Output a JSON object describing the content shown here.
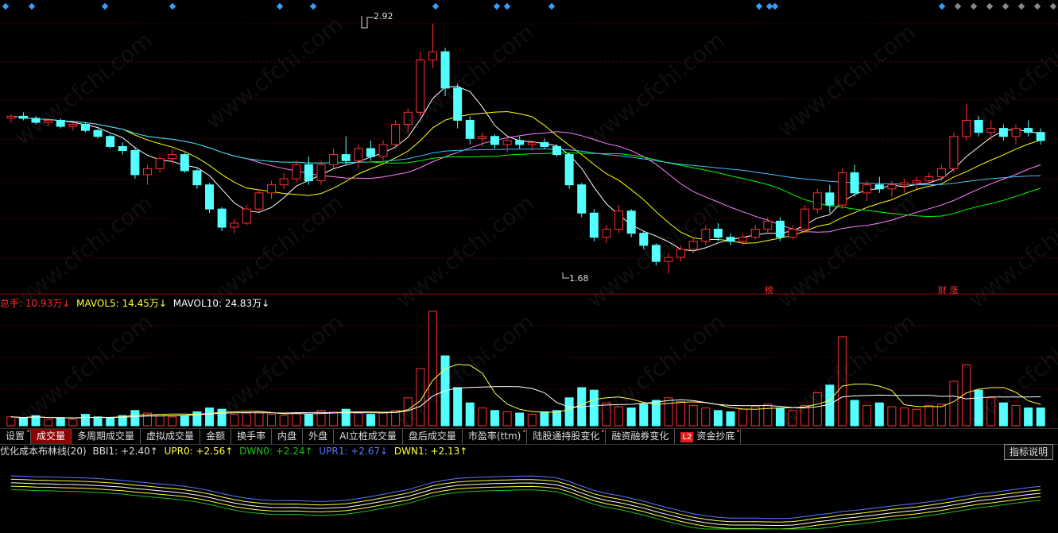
{
  "price_labels": {
    "high": "2.92",
    "low": "1.68"
  },
  "event_labels": [
    "榜",
    "财 涨"
  ],
  "volume_legend": {
    "total": "总手: 10.93万↓",
    "mavol5": "MAVOL5: 14.45万↓",
    "mavol10": "MAVOL10: 24.83万↓"
  },
  "indicator_legend": {
    "name": "优化成本布林线(20)",
    "bbi1": "BBI1: +2.40↑",
    "upr0": "UPR0: +2.56↑",
    "dwn0": "DWN0: +2.24↑",
    "upr1": "UPR1: +2.67↓",
    "dwn1": "DWN1: +2.13↑"
  },
  "tabs": [
    {
      "label": "设置",
      "dot": true
    },
    {
      "label": "成交量",
      "active": true
    },
    {
      "label": "多周期成交量"
    },
    {
      "label": "虚拟成交量"
    },
    {
      "label": "金额"
    },
    {
      "label": "换手率"
    },
    {
      "label": "内盘"
    },
    {
      "label": "外盘"
    },
    {
      "label": "AI立桩成交量"
    },
    {
      "label": "盘后成交量"
    },
    {
      "label": "市盈率(ttm)",
      "dot": true
    },
    {
      "label": "陆股通持股变化",
      "dot": true
    },
    {
      "label": "融资融券变化"
    },
    {
      "label": "资金抄底",
      "badge": "L2",
      "dot": true
    }
  ],
  "help_button": "指标说明",
  "watermark": "www.cfchi.com",
  "colors": {
    "up": "#ff3030",
    "down": "#54ffff",
    "ma5": "#ffffff",
    "ma10": "#ffff00",
    "ma20": "#ff80ff",
    "ma30": "#00ff00",
    "ma60": "#40c0ff",
    "grid": "#5a0000",
    "diamond": "#2fa0ff"
  },
  "chart_data": {
    "type": "candlestick",
    "price_high": 2.92,
    "price_low": 1.68,
    "candles": [
      [
        2.45,
        2.47,
        2.43,
        2.46
      ],
      [
        2.46,
        2.48,
        2.44,
        2.45
      ],
      [
        2.45,
        2.46,
        2.42,
        2.43
      ],
      [
        2.43,
        2.45,
        2.41,
        2.44
      ],
      [
        2.44,
        2.45,
        2.4,
        2.41
      ],
      [
        2.41,
        2.43,
        2.39,
        2.42
      ],
      [
        2.42,
        2.43,
        2.38,
        2.39
      ],
      [
        2.39,
        2.4,
        2.35,
        2.36
      ],
      [
        2.36,
        2.37,
        2.3,
        2.31
      ],
      [
        2.31,
        2.33,
        2.27,
        2.29
      ],
      [
        2.29,
        2.31,
        2.15,
        2.17
      ],
      [
        2.17,
        2.22,
        2.12,
        2.2
      ],
      [
        2.2,
        2.26,
        2.18,
        2.25
      ],
      [
        2.25,
        2.3,
        2.22,
        2.27
      ],
      [
        2.27,
        2.28,
        2.18,
        2.19
      ],
      [
        2.19,
        2.2,
        2.1,
        2.12
      ],
      [
        2.12,
        2.13,
        1.98,
        2.0
      ],
      [
        2.0,
        2.01,
        1.89,
        1.91
      ],
      [
        1.91,
        1.95,
        1.88,
        1.93
      ],
      [
        1.93,
        2.02,
        1.92,
        2.0
      ],
      [
        2.0,
        2.1,
        1.99,
        2.08
      ],
      [
        2.08,
        2.14,
        2.05,
        2.12
      ],
      [
        2.12,
        2.18,
        2.1,
        2.15
      ],
      [
        2.15,
        2.24,
        2.13,
        2.22
      ],
      [
        2.22,
        2.26,
        2.12,
        2.14
      ],
      [
        2.14,
        2.24,
        2.12,
        2.22
      ],
      [
        2.22,
        2.3,
        2.2,
        2.27
      ],
      [
        2.27,
        2.36,
        2.22,
        2.24
      ],
      [
        2.24,
        2.32,
        2.2,
        2.3
      ],
      [
        2.3,
        2.34,
        2.24,
        2.26
      ],
      [
        2.26,
        2.34,
        2.24,
        2.32
      ],
      [
        2.32,
        2.44,
        2.3,
        2.42
      ],
      [
        2.42,
        2.5,
        2.38,
        2.48
      ],
      [
        2.48,
        2.78,
        2.46,
        2.74
      ],
      [
        2.74,
        2.92,
        2.7,
        2.78
      ],
      [
        2.78,
        2.8,
        2.56,
        2.6
      ],
      [
        2.6,
        2.62,
        2.4,
        2.44
      ],
      [
        2.44,
        2.46,
        2.32,
        2.35
      ],
      [
        2.35,
        2.38,
        2.31,
        2.36
      ],
      [
        2.36,
        2.37,
        2.3,
        2.32
      ],
      [
        2.32,
        2.36,
        2.28,
        2.34
      ],
      [
        2.34,
        2.36,
        2.3,
        2.32
      ],
      [
        2.32,
        2.34,
        2.29,
        2.33
      ],
      [
        2.33,
        2.35,
        2.3,
        2.31
      ],
      [
        2.31,
        2.32,
        2.26,
        2.27
      ],
      [
        2.27,
        2.28,
        2.1,
        2.12
      ],
      [
        2.12,
        2.13,
        1.96,
        1.98
      ],
      [
        1.98,
        2.0,
        1.84,
        1.86
      ],
      [
        1.86,
        1.92,
        1.83,
        1.9
      ],
      [
        1.9,
        2.02,
        1.88,
        1.99
      ],
      [
        1.99,
        2.0,
        1.86,
        1.88
      ],
      [
        1.88,
        1.89,
        1.8,
        1.82
      ],
      [
        1.82,
        1.83,
        1.72,
        1.74
      ],
      [
        1.74,
        1.78,
        1.68,
        1.76
      ],
      [
        1.76,
        1.82,
        1.74,
        1.8
      ],
      [
        1.8,
        1.86,
        1.78,
        1.84
      ],
      [
        1.84,
        1.92,
        1.82,
        1.9
      ],
      [
        1.9,
        1.93,
        1.84,
        1.86
      ],
      [
        1.86,
        1.88,
        1.82,
        1.84
      ],
      [
        1.84,
        1.88,
        1.82,
        1.86
      ],
      [
        1.86,
        1.92,
        1.85,
        1.9
      ],
      [
        1.9,
        1.96,
        1.88,
        1.94
      ],
      [
        1.94,
        1.96,
        1.84,
        1.86
      ],
      [
        1.86,
        1.92,
        1.85,
        1.9
      ],
      [
        1.9,
        2.02,
        1.88,
        2.0
      ],
      [
        2.0,
        2.1,
        1.98,
        2.08
      ],
      [
        2.08,
        2.12,
        1.98,
        2.02
      ],
      [
        2.02,
        2.2,
        2.0,
        2.18
      ],
      [
        2.18,
        2.22,
        2.06,
        2.08
      ],
      [
        2.08,
        2.14,
        2.04,
        2.12
      ],
      [
        2.12,
        2.16,
        2.08,
        2.1
      ],
      [
        2.1,
        2.14,
        2.06,
        2.12
      ],
      [
        2.12,
        2.15,
        2.08,
        2.13
      ],
      [
        2.13,
        2.16,
        2.1,
        2.14
      ],
      [
        2.14,
        2.18,
        2.12,
        2.16
      ],
      [
        2.16,
        2.22,
        2.14,
        2.2
      ],
      [
        2.2,
        2.38,
        2.18,
        2.36
      ],
      [
        2.36,
        2.52,
        2.34,
        2.44
      ],
      [
        2.44,
        2.46,
        2.36,
        2.38
      ],
      [
        2.38,
        2.44,
        2.34,
        2.4
      ],
      [
        2.4,
        2.42,
        2.34,
        2.36
      ],
      [
        2.36,
        2.42,
        2.32,
        2.4
      ],
      [
        2.4,
        2.44,
        2.36,
        2.38
      ],
      [
        2.38,
        2.4,
        2.32,
        2.34
      ]
    ],
    "volume": [
      7,
      6,
      8,
      5,
      6,
      5,
      9,
      7,
      6,
      8,
      12,
      10,
      9,
      7,
      8,
      11,
      14,
      13,
      9,
      10,
      11,
      9,
      8,
      10,
      9,
      12,
      11,
      13,
      10,
      9,
      10,
      12,
      22,
      45,
      90,
      55,
      30,
      18,
      14,
      12,
      11,
      10,
      9,
      11,
      12,
      22,
      30,
      28,
      18,
      15,
      14,
      17,
      20,
      22,
      19,
      16,
      14,
      12,
      11,
      13,
      15,
      17,
      14,
      12,
      16,
      26,
      32,
      70,
      20,
      16,
      18,
      15,
      14,
      13,
      16,
      17,
      35,
      48,
      28,
      22,
      18,
      16,
      14,
      14
    ],
    "volume_ma5_label": "MAVOL5: 14.45万",
    "volume_ma10_label": "MAVOL10: 24.83万"
  }
}
